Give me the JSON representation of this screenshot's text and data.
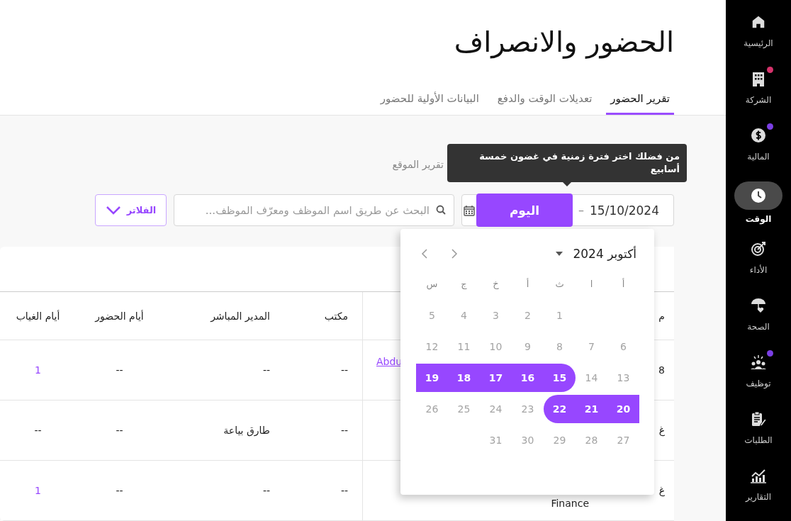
{
  "sidebar": {
    "items": [
      {
        "label": "الرئيسية",
        "selected": false
      },
      {
        "label": "الشركة",
        "selected": false,
        "color": "#d6336c"
      },
      {
        "label": "المالية",
        "selected": false,
        "color": "#7b3fe4"
      },
      {
        "label": "الوقت",
        "selected": true
      },
      {
        "label": "الأداء",
        "selected": false
      },
      {
        "label": "الصحة",
        "selected": false
      },
      {
        "label": "توظيف",
        "selected": false,
        "color": "#7b3fe4"
      },
      {
        "label": "الطلبات",
        "selected": false
      },
      {
        "label": "التقارير",
        "selected": false
      }
    ]
  },
  "page_title": "الحضور والانصراف",
  "tabs": [
    {
      "label": "تقرير الحضور",
      "selected": true
    },
    {
      "label": "تعديلات الوقت والدفع",
      "selected": false
    },
    {
      "label": "البيانات الأولية للحضور",
      "selected": false
    }
  ],
  "subtabs": [
    {
      "label": "تقرير الموقع",
      "selected": false
    }
  ],
  "tooltip": "من فضلك اختر فترة زمنية في غضون خمسة أسابيع",
  "date_field": {
    "value": "15/10/2024",
    "separator": "–"
  },
  "today_button": "اليوم",
  "search": {
    "placeholder": "البحث عن طريق اسم الموظف ومعرّف الموظف..."
  },
  "filters_button": "الفلاتر",
  "calendar": {
    "month_label": "أكتوبر 2024",
    "weekdays": [
      "أ",
      "ا",
      "ث",
      "أ",
      "خ",
      "ج",
      "س"
    ],
    "weeks": [
      {
        "days": [
          {
            "label": "1",
            "selected": false
          },
          {
            "label": "2",
            "selected": false
          },
          {
            "label": "3",
            "selected": false
          },
          {
            "label": "4",
            "selected": false
          },
          {
            "label": "5",
            "selected": false
          }
        ]
      },
      {
        "days": [
          {
            "label": "6",
            "selected": false
          },
          {
            "label": "7",
            "selected": false
          },
          {
            "label": "8",
            "selected": false
          },
          {
            "label": "9",
            "selected": false
          },
          {
            "label": "10",
            "selected": false
          },
          {
            "label": "11",
            "selected": false
          },
          {
            "label": "12",
            "selected": false
          }
        ]
      },
      {
        "days": [
          {
            "label": "13",
            "selected": false
          },
          {
            "label": "14",
            "selected": false
          },
          {
            "label": "15",
            "selected": true
          },
          {
            "label": "16",
            "selected": true
          },
          {
            "label": "17",
            "selected": true
          },
          {
            "label": "18",
            "selected": true
          },
          {
            "label": "19",
            "selected": true
          }
        ]
      },
      {
        "days": [
          {
            "label": "20",
            "selected": true
          },
          {
            "label": "21",
            "selected": true
          },
          {
            "label": "22",
            "selected": true
          },
          {
            "label": "23",
            "selected": false
          },
          {
            "label": "24",
            "selected": false
          },
          {
            "label": "25",
            "selected": false
          },
          {
            "label": "26",
            "selected": false
          }
        ]
      },
      {
        "days": [
          {
            "label": "27",
            "selected": false
          },
          {
            "label": "28",
            "selected": false
          },
          {
            "label": "29",
            "selected": false
          },
          {
            "label": "30",
            "selected": false
          },
          {
            "label": "31",
            "selected": false
          }
        ]
      }
    ]
  },
  "table": {
    "columns": [
      {
        "label": "م"
      },
      {},
      {
        "label": "مكتب"
      },
      {
        "label": "المدير المباشر"
      },
      {
        "label": "أيام الحضور"
      },
      {
        "label": "أيام الغياب"
      }
    ],
    "rows": [
      [
        {
          "text": "8"
        },
        {
          "text": "Abdu",
          "kind": "link"
        },
        {
          "text": "--"
        },
        {
          "text": "--"
        },
        {
          "text": "--"
        },
        {
          "text": "1",
          "kind": "count"
        }
      ],
      [
        {
          "text": "غ"
        },
        {},
        {
          "text": "--"
        },
        {
          "text": "طارق بياعة"
        },
        {
          "text": "--"
        },
        {
          "text": "--"
        }
      ],
      [
        {
          "text": "غ"
        },
        {
          "text": "Finance",
          "kind": "sub"
        },
        {
          "text": "--"
        },
        {
          "text": "--"
        },
        {
          "text": "--"
        },
        {
          "text": "1",
          "kind": "count"
        }
      ]
    ]
  }
}
